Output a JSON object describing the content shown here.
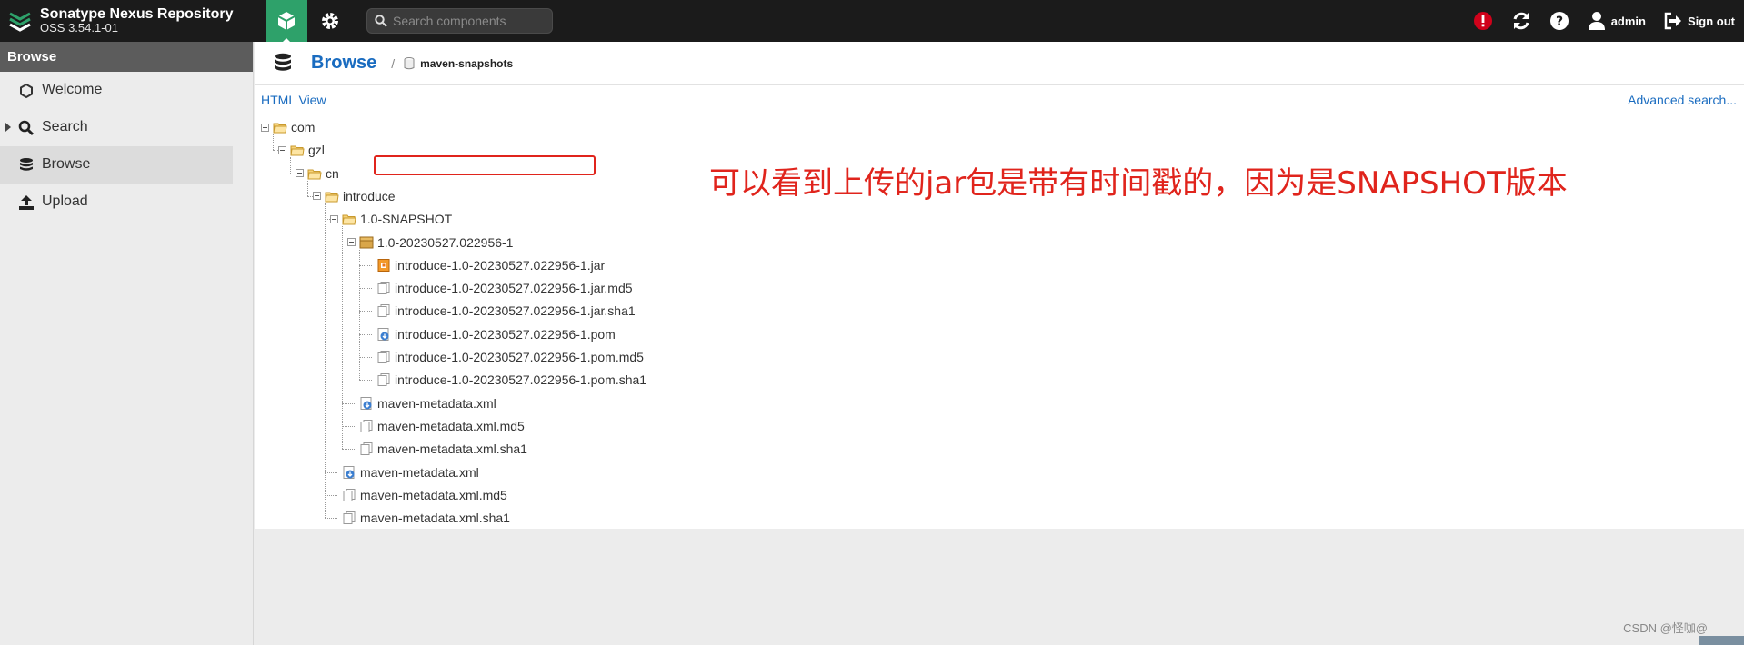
{
  "app": {
    "title": "Sonatype Nexus Repository",
    "version": "OSS 3.54.1-01"
  },
  "header": {
    "search_placeholder": "Search components",
    "user_label": "admin",
    "signout_label": "Sign out"
  },
  "sidebar": {
    "heading": "Browse",
    "items": [
      {
        "label": "Welcome",
        "icon": "hexagon-icon"
      },
      {
        "label": "Search",
        "icon": "search-icon"
      },
      {
        "label": "Browse",
        "icon": "database-icon"
      },
      {
        "label": "Upload",
        "icon": "upload-icon"
      }
    ]
  },
  "breadcrumb": {
    "title": "Browse",
    "separator": "/",
    "repo": "maven-snapshots"
  },
  "links": {
    "html_view": "HTML View",
    "advanced_search": "Advanced search..."
  },
  "tree": [
    {
      "label": "com",
      "type": "folder"
    },
    {
      "label": "gzl",
      "type": "folder"
    },
    {
      "label": "cn",
      "type": "folder"
    },
    {
      "label": "introduce",
      "type": "folder"
    },
    {
      "label": "1.0-SNAPSHOT",
      "type": "folder"
    },
    {
      "label": "1.0-20230527.022956-1",
      "type": "package"
    },
    {
      "label": "introduce-1.0-20230527.022956-1.jar",
      "type": "jar"
    },
    {
      "label": "introduce-1.0-20230527.022956-1.jar.md5",
      "type": "file"
    },
    {
      "label": "introduce-1.0-20230527.022956-1.jar.sha1",
      "type": "file"
    },
    {
      "label": "introduce-1.0-20230527.022956-1.pom",
      "type": "xml"
    },
    {
      "label": "introduce-1.0-20230527.022956-1.pom.md5",
      "type": "file"
    },
    {
      "label": "introduce-1.0-20230527.022956-1.pom.sha1",
      "type": "file"
    },
    {
      "label": "maven-metadata.xml",
      "type": "xml"
    },
    {
      "label": "maven-metadata.xml.md5",
      "type": "file"
    },
    {
      "label": "maven-metadata.xml.sha1",
      "type": "file"
    },
    {
      "label": "maven-metadata.xml",
      "type": "xml"
    },
    {
      "label": "maven-metadata.xml.md5",
      "type": "file"
    },
    {
      "label": "maven-metadata.xml.sha1",
      "type": "file"
    }
  ],
  "annotation": "可以看到上传的jar包是带有时间戳的，因为是SNAPSHOT版本",
  "watermark": "CSDN @怪咖@",
  "colors": {
    "accent": "#2ea16a",
    "link": "#1a6cc0",
    "annotation": "#e0241c",
    "alert": "#d0021b"
  }
}
